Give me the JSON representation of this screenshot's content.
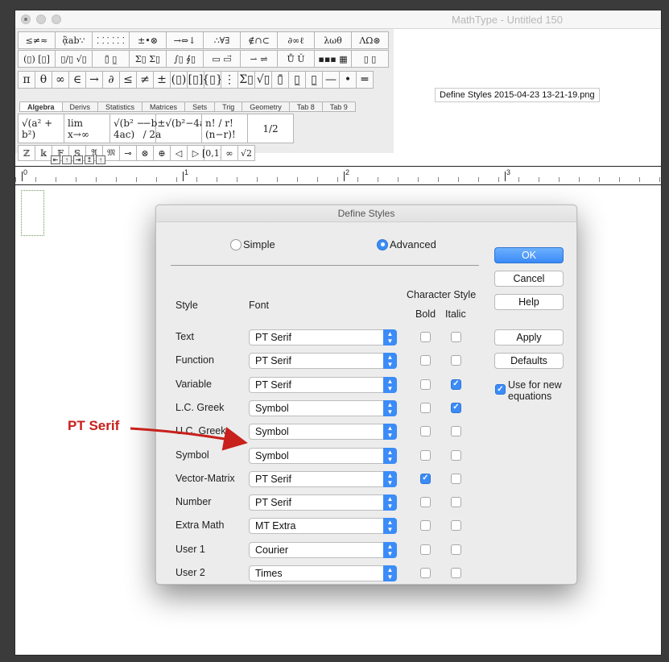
{
  "window": {
    "title": "MathType - Untitled 150"
  },
  "toolbar": {
    "row1": [
      "≤≠≈",
      "ᾃab∵",
      "⸬ ⸬ ⸬",
      "±•⊗",
      "→⇔↓",
      "∴∀∃",
      "∉∩⊂",
      "∂∞ℓ",
      "λωθ",
      "ΛΩ⊛"
    ],
    "row2": [
      "(▯) [▯]",
      "▯/▯ √▯",
      "▯̄ ▯̲",
      "Σ▯ Σ▯",
      "∫▯ ∮▯",
      "▭ ▭⃗",
      "⇀ ⇌",
      "Ů Ǔ",
      "▪▪▪ ▦",
      "▯ ▯"
    ],
    "row3": [
      "π",
      "θ",
      "∞",
      "∈",
      "→",
      "∂",
      "≤",
      "≠",
      "±",
      "(▯)",
      "[▯]",
      "{▯}",
      "⋮",
      "Σ▯",
      "√▯",
      "▯̄",
      "▯̲",
      "▯̲",
      "—",
      "•",
      "═"
    ],
    "tabs": [
      "Algebra",
      "Derivs",
      "Statistics",
      "Matrices",
      "Sets",
      "Trig",
      "Geometry",
      "Tab 8",
      "Tab 9"
    ],
    "templates": [
      "√(a² + b²)",
      "lim x→∞",
      "√(b² − 4ac)",
      "−b±√(b²−4ac) / 2a",
      "n! / r!(n−r)!",
      "1/2"
    ],
    "small": [
      "ℤ",
      "𝕜",
      "𝔽",
      "𝕊",
      "𝔄",
      "𝔐",
      "⊸",
      "⊗",
      "⊕",
      "◁",
      "▷",
      "[0,1]",
      "∞",
      "√2"
    ]
  },
  "file_label": "Define Styles 2015-04-23 13-21-19.png",
  "ruler": {
    "marks": [
      "0",
      "1",
      "2",
      "3"
    ]
  },
  "dialog": {
    "title": "Define Styles",
    "radio_simple": "Simple",
    "radio_advanced": "Advanced",
    "selected_mode": "Advanced",
    "col_style": "Style",
    "col_font": "Font",
    "col_char_style": "Character Style",
    "col_bold": "Bold",
    "col_italic": "Italic",
    "rows": [
      {
        "style": "Text",
        "font": "PT Serif",
        "bold": false,
        "italic": false
      },
      {
        "style": "Function",
        "font": "PT Serif",
        "bold": false,
        "italic": false
      },
      {
        "style": "Variable",
        "font": "PT Serif",
        "bold": false,
        "italic": true
      },
      {
        "style": "L.C. Greek",
        "font": "Symbol",
        "bold": false,
        "italic": true
      },
      {
        "style": "U.C. Greek",
        "font": "Symbol",
        "bold": false,
        "italic": false
      },
      {
        "style": "Symbol",
        "font": "Symbol",
        "bold": false,
        "italic": false
      },
      {
        "style": "Vector-Matrix",
        "font": "PT Serif",
        "bold": true,
        "italic": false
      },
      {
        "style": "Number",
        "font": "PT Serif",
        "bold": false,
        "italic": false
      },
      {
        "style": "Extra Math",
        "font": "MT Extra",
        "bold": false,
        "italic": false
      },
      {
        "style": "User 1",
        "font": "Courier",
        "bold": false,
        "italic": false
      },
      {
        "style": "User 2",
        "font": "Times",
        "bold": false,
        "italic": false
      }
    ],
    "buttons": {
      "ok": "OK",
      "cancel": "Cancel",
      "help": "Help",
      "apply": "Apply",
      "defaults": "Defaults"
    },
    "use_for_new": {
      "label_line1": "Use for new",
      "label_line2": "equations",
      "checked": true
    }
  },
  "annotation": {
    "text": "PT Serif",
    "color": "#c8201b"
  },
  "colors": {
    "accent": "#3b8cf7",
    "annotation": "#c8201b"
  }
}
